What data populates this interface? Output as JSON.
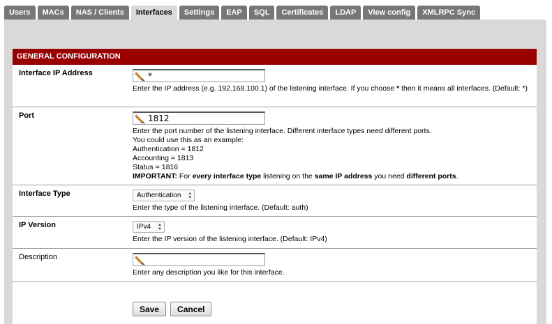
{
  "tabs": [
    {
      "label": "Users"
    },
    {
      "label": "MACs"
    },
    {
      "label": "NAS / Clients"
    },
    {
      "label": "Interfaces",
      "active": true
    },
    {
      "label": "Settings"
    },
    {
      "label": "EAP"
    },
    {
      "label": "SQL"
    },
    {
      "label": "Certificates"
    },
    {
      "label": "LDAP"
    },
    {
      "label": "View config"
    },
    {
      "label": "XMLRPC Sync"
    }
  ],
  "section_title": "GENERAL CONFIGURATION",
  "fields": {
    "ip": {
      "label": "Interface IP Address",
      "value": "*",
      "help_a": "Enter the IP address (e.g. 192.168.100.1) of the listening interface. If you choose ",
      "help_b": "*",
      "help_c": " then it means all interfaces. (Default: *)"
    },
    "port": {
      "label": "Port",
      "value": "1812",
      "help_1": "Enter the port number of the listening interface. Different interface types need different ports.",
      "help_2": "You could use this as an example:",
      "help_3": "Authentication = 1812",
      "help_4": "Accounting = 1813",
      "help_5": "Status = 1816",
      "imp_1": "IMPORTANT:",
      "imp_2": " For ",
      "imp_3": "every interface type",
      "imp_4": " listening on the ",
      "imp_5": "same IP address",
      "imp_6": " you need ",
      "imp_7": "different ports",
      "imp_8": "."
    },
    "type": {
      "label": "Interface Type",
      "selected": "Authentication",
      "help": "Enter the type of the listening interface. (Default: auth)"
    },
    "ipver": {
      "label": "IP Version",
      "selected": "IPv4",
      "help": "Enter the IP version of the listening interface. (Default: IPv4)"
    },
    "desc": {
      "label": "Description",
      "value": "",
      "help": "Enter any description you like for this interface."
    }
  },
  "buttons": {
    "save": "Save",
    "cancel": "Cancel"
  },
  "colors": {
    "header_bg": "#990000",
    "tab_bg": "#777777",
    "panel_bg": "#d9d9d9"
  }
}
